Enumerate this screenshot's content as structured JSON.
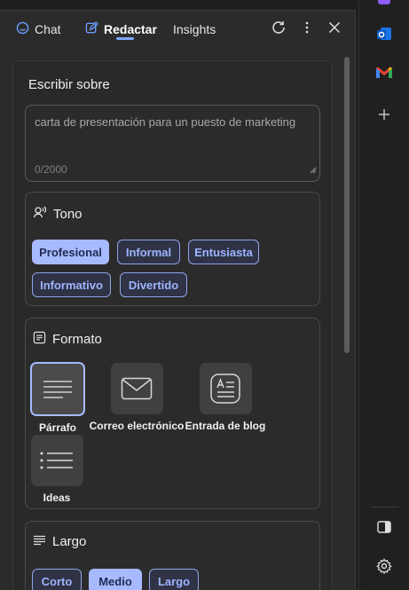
{
  "tabs": [
    {
      "label": "Chat",
      "icon": "chat-icon"
    },
    {
      "label": "Redactar",
      "icon": "compose-icon",
      "active": true
    },
    {
      "label": "Insights"
    }
  ],
  "write_about": {
    "label": "Escribir sobre",
    "placeholder": "carta de presentación para un puesto de marketing",
    "counter": "0/2000"
  },
  "tone": {
    "title": "Tono",
    "options": [
      "Profesional",
      "Informal",
      "Entusiasta",
      "Informativo",
      "Divertido"
    ],
    "selected": "Profesional"
  },
  "format": {
    "title": "Formato",
    "options": [
      "Párrafo",
      "Correo electrónico",
      "Entrada de blog",
      "Ideas"
    ],
    "selected": "Párrafo"
  },
  "length": {
    "title": "Largo",
    "options": [
      "Corto",
      "Medio",
      "Largo"
    ],
    "selected": "Medio"
  },
  "colors": {
    "accent": "#a7baff",
    "chip_text": "#9fb3ff",
    "outlook": "#1a73e8",
    "gmail": "#ea4335"
  }
}
